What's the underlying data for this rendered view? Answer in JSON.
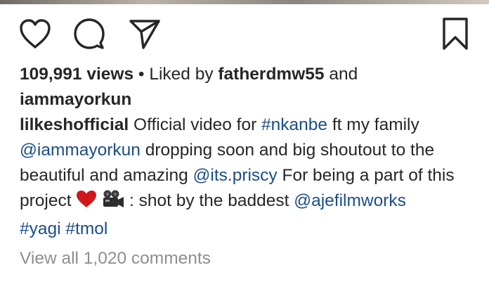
{
  "post": {
    "actions": {
      "like": "heart-icon",
      "comment": "comment-icon",
      "share": "paper-plane-icon",
      "save": "bookmark-icon"
    },
    "views_count": "109,991 views",
    "separator": " • ",
    "liked_by_prefix": "Liked by ",
    "liked_by_user": "fatherdmw55",
    "liked_and": " and",
    "liked_by_other": "iammayorkun",
    "caption": {
      "username": "lilkeshofficial",
      "t1": " Official video for ",
      "tag_nkanbe": "#nkanbe",
      "t2": " ft my family",
      "mention_iammayorkun": "@iammayorkun",
      "t3": " dropping soon and big shoutout to the beautiful and amazing ",
      "mention_priscy": "@its.priscy",
      "t4": " For being a part of this project ",
      "t5": " : shot by the baddest ",
      "mention_aje": "@ajefilmworks",
      "tag_yagi": "#yagi",
      "tag_tmol": "#tmol"
    },
    "view_comments": "View all 1,020 comments"
  },
  "colors": {
    "text": "#262626",
    "link": "#1d4d86",
    "muted": "#8e8e8e",
    "heart": "#d0171b"
  }
}
